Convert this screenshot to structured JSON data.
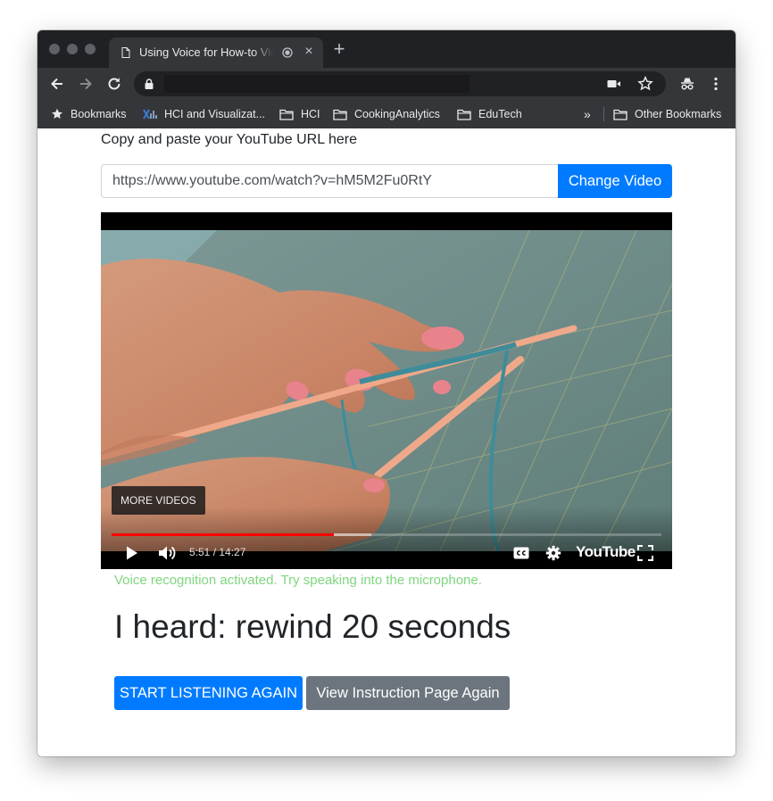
{
  "browser": {
    "tab": {
      "title": "Using Voice for How-to Vid",
      "close_icon": "close-icon"
    },
    "new_tab_icon": "plus-icon",
    "toolbar": {
      "icons": [
        "back-arrow-icon",
        "forward-arrow-icon",
        "reload-icon",
        "lock-icon",
        "camera-icon",
        "star-icon",
        "incognito-icon",
        "menu-kebab-icon"
      ]
    },
    "bookmarks": {
      "items": [
        {
          "label": "Bookmarks",
          "icon": "star-icon"
        },
        {
          "label": "HCI and Visualizat...",
          "icon": "chart-favicon-icon"
        },
        {
          "label": "HCI",
          "icon": "folder-icon"
        },
        {
          "label": "CookingAnalytics",
          "icon": "folder-icon"
        },
        {
          "label": "EduTech",
          "icon": "folder-icon"
        }
      ],
      "overflow": "»",
      "other": {
        "label": "Other Bookmarks",
        "icon": "folder-icon"
      }
    }
  },
  "page": {
    "url_label": "Copy and paste your YouTube URL here",
    "url_value": "https://www.youtube.com/watch?v=hM5M2Fu0RtY",
    "change_button": "Change Video",
    "video": {
      "more_videos": "MORE VIDEOS",
      "time": "5:51 / 14:27",
      "played_fraction": 0.405,
      "buffered_fraction": 0.473,
      "logo_text": "YouTube"
    },
    "status": "Voice recognition activated. Try speaking into the microphone.",
    "heard": "I heard: rewind 20 seconds",
    "start_button": "START LISTENING AGAIN",
    "view_button": "View Instruction Page Again"
  },
  "colors": {
    "primary": "#007bff",
    "secondary": "#6c757d",
    "status_green": "#7ed67e",
    "progress_red": "#ff0000",
    "chrome_dark": "#202124",
    "chrome_toolbar": "#35363a"
  }
}
